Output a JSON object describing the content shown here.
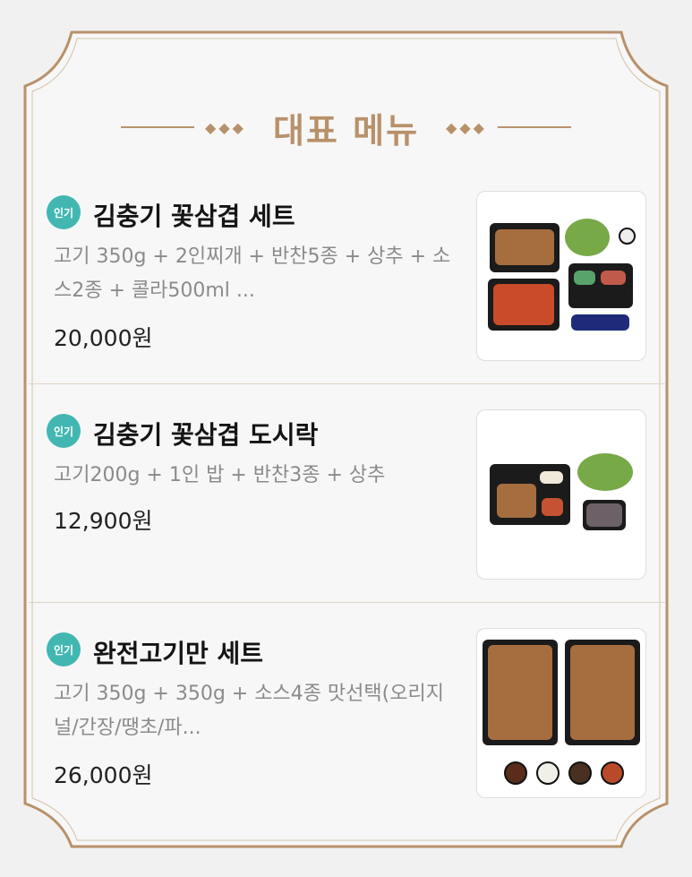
{
  "header": {
    "title": "대표 메뉴",
    "decor_left": "◆◆◆",
    "decor_right": "◆◆◆"
  },
  "menu": [
    {
      "badge": "인기",
      "name": "김충기 꽃삼겹 세트",
      "description": "고기 350g + 2인찌개 + 반찬5종 + 상추 + 소스2종 + 콜라500ml ...",
      "price": "20,000원"
    },
    {
      "badge": "인기",
      "name": "김충기 꽃삼겹 도시락",
      "description": "고기200g + 1인 밥 + 반찬3종 + 상추",
      "price": "12,900원"
    },
    {
      "badge": "인기",
      "name": "완전고기만 세트",
      "description": "고기 350g + 350g + 소스4종 맛선택(오리지널/간장/땡초/파...",
      "price": "26,000원"
    }
  ],
  "colors": {
    "accent": "#b8916a",
    "badge": "#42b7b2",
    "background": "#f7f7f7"
  },
  "icons": {
    "title_decor": "diamond-ornament-icon",
    "badge": "popular-badge-icon"
  }
}
